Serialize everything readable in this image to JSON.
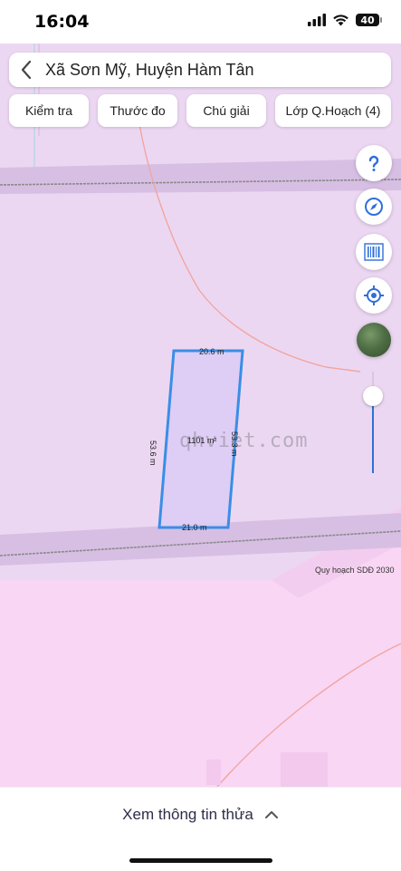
{
  "status": {
    "time": "16:04",
    "battery": "40"
  },
  "header": {
    "location": "Xã Sơn Mỹ, Huyện Hàm Tân"
  },
  "toolbar": {
    "check_label": "Kiểm tra",
    "measure_label": "Thước đo",
    "legend_label": "Chú giải",
    "layers_label": "Lớp Q.Hoạch (4)"
  },
  "map": {
    "parcel": {
      "area": "1101 m²",
      "edge_top": "20.6 m",
      "edge_bottom": "21.0 m",
      "edge_left": "53.6 m",
      "edge_right": "53.3 m",
      "outline_color": "#3a8ee6"
    },
    "planning_label": "Quy hoạch SDĐ 2030",
    "watermark": "qhviet.com",
    "zoom_level": 0.75,
    "colors": {
      "land_light": "#ecd7f2",
      "land_pink": "#f9d6f4",
      "road_band": "#d7bfe4",
      "accent": "#2f6fd9"
    }
  },
  "side_controls": {
    "help_icon": "question-icon",
    "compass_icon": "compass-icon",
    "barcode_icon": "barcode-icon",
    "locate_icon": "crosshair-icon"
  },
  "bottom": {
    "info_label": "Xem thông tin thửa"
  }
}
